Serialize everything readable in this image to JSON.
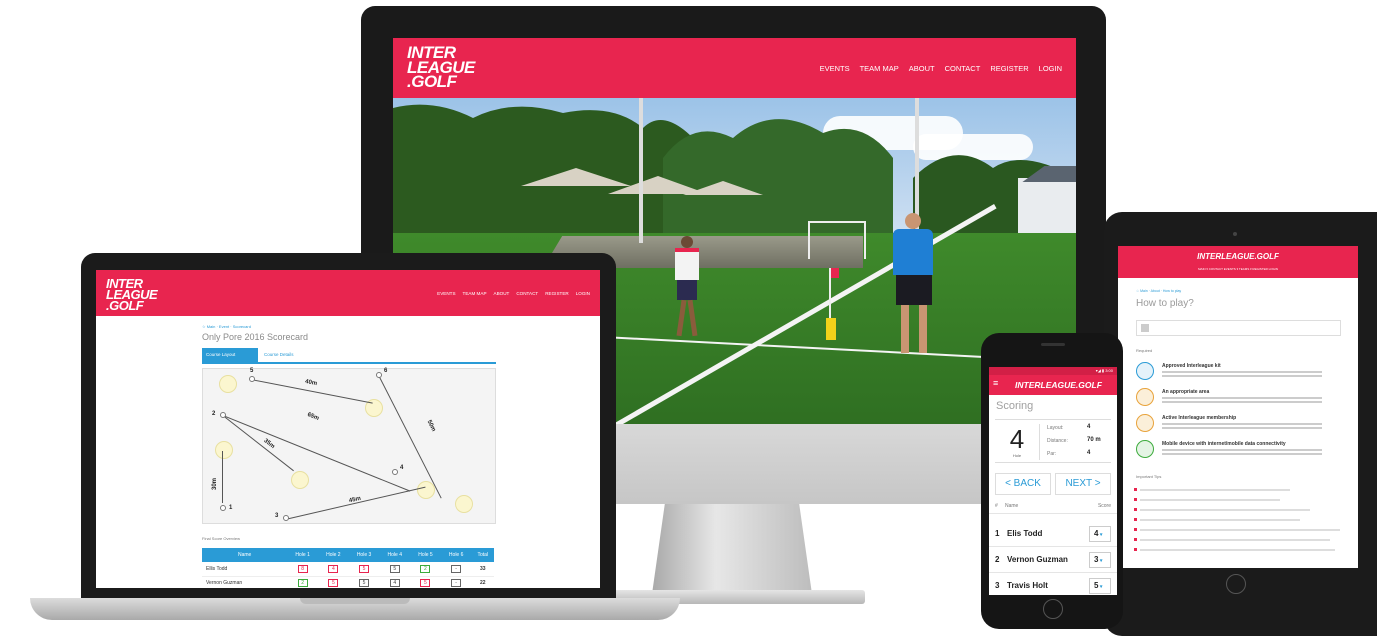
{
  "brand": {
    "logo_lines": [
      "INTER",
      "LEAGUE",
      ".GOLF"
    ],
    "logo_inline": "INTERLEAGUE.GOLF",
    "accent": "#e8254f",
    "table_blue": "#2a9bd6"
  },
  "desktop": {
    "nav": [
      "EVENTS",
      "TEAM MAP",
      "ABOUT",
      "CONTACT",
      "REGISTER",
      "LOGIN"
    ]
  },
  "laptop": {
    "nav": [
      "EVENTS",
      "TEAM MAP",
      "ABOUT",
      "CONTACT",
      "REGISTER",
      "LOGIN"
    ],
    "breadcrumb": "☆ Main · Event · Scorecard",
    "page_title": "Only Pore 2016 Scorecard",
    "tabs": [
      "Course Layout",
      "Course Details"
    ],
    "distances": [
      "40m",
      "65m",
      "35m",
      "30m",
      "45m",
      "50m"
    ],
    "tee_numbers": [
      "5",
      "6",
      "2",
      "4",
      "1",
      "3"
    ],
    "table_caption": "Final Score Overview",
    "table_headers": [
      "Name",
      "Hole 1",
      "Hole 2",
      "Hole 3",
      "Hole 4",
      "Hole 5",
      "Hole 6",
      "Total"
    ],
    "rows": [
      {
        "name": "Ellis Todd",
        "scores": [
          "8",
          "4",
          "5",
          "5",
          "2",
          "-"
        ],
        "total": "33"
      },
      {
        "name": "Vernon Guzman",
        "scores": [
          "2",
          "5",
          "5",
          "4",
          "5",
          "-"
        ],
        "total": "22"
      }
    ]
  },
  "phone": {
    "status": "▾◢ ▮ 3:00",
    "menu_icon": "≡",
    "title": "Scoring",
    "hole_number": "4",
    "hole_label": "Hole",
    "details": [
      {
        "label": "Layout:",
        "value": "4"
      },
      {
        "label": "Distance:",
        "value": "70 m"
      },
      {
        "label": "Par:",
        "value": "4"
      }
    ],
    "back_label": "< BACK",
    "next_label": "NEXT >",
    "col_num": "#",
    "col_name": "Name",
    "col_score": "Score",
    "players": [
      {
        "rank": "1",
        "name": "Elis Todd",
        "score": "4"
      },
      {
        "rank": "2",
        "name": "Vernon Guzman",
        "score": "3"
      },
      {
        "rank": "3",
        "name": "Travis Holt",
        "score": "5"
      }
    ]
  },
  "tablet": {
    "nav_small": "MAIN ▾  CONTACT  EVENTS ▾  TEAMS ▾  REGISTER  LOGIN",
    "breadcrumb": "☆ Main · About · How to play",
    "page_title": "How to play?",
    "section_required": "Required",
    "requirements": [
      {
        "title": "Approved Interleague kit",
        "color": "#2a9bd6"
      },
      {
        "title": "An appropriate area",
        "color": "#e8a23a"
      },
      {
        "title": "Active Interleague membership",
        "color": "#e8a23a"
      },
      {
        "title": "Mobile device with internet/mobile data connectivity",
        "color": "#3cab3c"
      }
    ],
    "section_tips": "Important Tips"
  }
}
